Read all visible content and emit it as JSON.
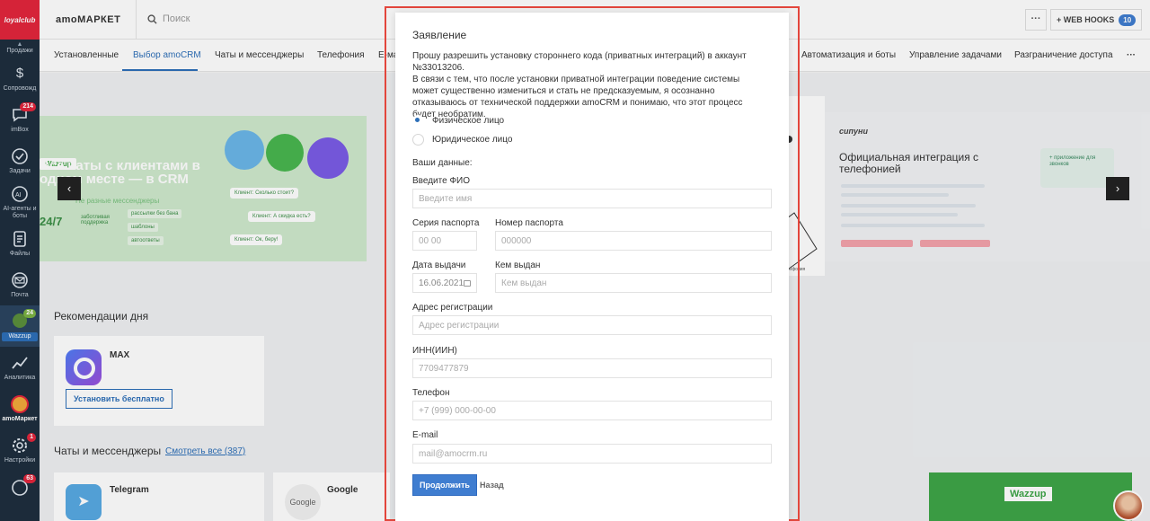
{
  "sidebar": {
    "logo": "loyalclub",
    "items": [
      {
        "label": "Продажи",
        "icon": "chevron-up-icon"
      },
      {
        "label": "Сопровожд",
        "icon": "dollar-icon"
      },
      {
        "label": "imBox",
        "icon": "chat-icon",
        "badge": "214"
      },
      {
        "label": "Задачи",
        "icon": "check-icon"
      },
      {
        "label": "AI-агенты и боты",
        "icon": "ai-icon"
      },
      {
        "label": "Файлы",
        "icon": "file-icon"
      },
      {
        "label": "Почта",
        "icon": "mail-icon"
      },
      {
        "label": "Wazzup",
        "badge": "24"
      },
      {
        "label": "Аналитика",
        "icon": "analytics-icon"
      },
      {
        "label": "amoМаркет",
        "icon": "market-icon"
      },
      {
        "label": "Настройки",
        "icon": "settings-icon",
        "badge": "1"
      },
      {
        "label": "",
        "icon": "phone-icon",
        "badge": "63"
      }
    ]
  },
  "topbar": {
    "title": "amoМАРКЕТ",
    "search_placeholder": "Поиск",
    "more": "···",
    "webhooks_label": "+ WEB HOOKS",
    "webhooks_count": "10"
  },
  "navtabs": [
    "Установленные",
    "Выбор amoCRM",
    "Чаты и мессенджеры",
    "Телефония",
    "E-ма",
    "Автоматизация и боты",
    "Управление задачами",
    "Разграничение доступа",
    "···"
  ],
  "background": {
    "banner_left": {
      "brand": "Wazzup",
      "headline": "Все чаты с клиентами в одном месте — в CRM",
      "subline": "Не разные мессенджеры",
      "support": "24/7",
      "support_note": "заботливая поддержка",
      "pills": [
        "рассылки без бана",
        "шаблоны",
        "автоответы"
      ],
      "chats": [
        "Клиент: Сколько стоит?",
        "Клиент: А скидка есть?",
        "Клиент: Ок, беру!"
      ]
    },
    "banner_right": {
      "brand": "сипуни",
      "title": "Официальная интеграция с телефонией",
      "card": "+ приложение для звонков",
      "mid_caption": "Телефония"
    },
    "recommendations_title": "Рекомендации дня",
    "rec_app_name": "MAX",
    "rec_install": "Установить бесплатно",
    "chats_section_title": "Чаты и мессенджеры",
    "chats_section_link": "Смотреть все (387)",
    "apps": [
      "Telegram",
      "Google"
    ],
    "google_icon_text": "Google",
    "wazzup_card": "Wazzup"
  },
  "modal": {
    "title": "Заявление",
    "text": "Прошу разрешить установку стороннего кода (приватных интеграций) в аккаунт №33013206.\nВ связи с тем, что после установки приватной интеграции поведение системы может существенно измениться и стать не предсказуемым, я осознанно отказываюсь от технической поддержки amoCRM и понимаю, что этот процесс будет необратим.",
    "radio_individual": "Физическое лицо",
    "radio_legal": "Юридическое лицо",
    "your_data": "Ваши данные:",
    "fio_label": "Введите ФИО",
    "fio_placeholder": "Введите имя",
    "passport_series_label": "Серия паспорта",
    "passport_series_placeholder": "00 00",
    "passport_number_label": "Номер паспорта",
    "passport_number_placeholder": "000000",
    "issue_date_label": "Дата выдачи",
    "issue_date_value": "16.06.2021",
    "issued_by_label": "Кем выдан",
    "issued_by_placeholder": "Кем выдан",
    "address_label": "Адрес регистрации",
    "address_placeholder": "Адрес регистрации",
    "inn_label": "ИНН(ИИН)",
    "inn_placeholder": "7709477879",
    "phone_label": "Телефон",
    "phone_placeholder": "+7 (999) 000-00-00",
    "email_label": "E-mail",
    "email_placeholder": "mail@amocrm.ru",
    "continue_button": "Продолжить",
    "back_button": "Назад"
  }
}
